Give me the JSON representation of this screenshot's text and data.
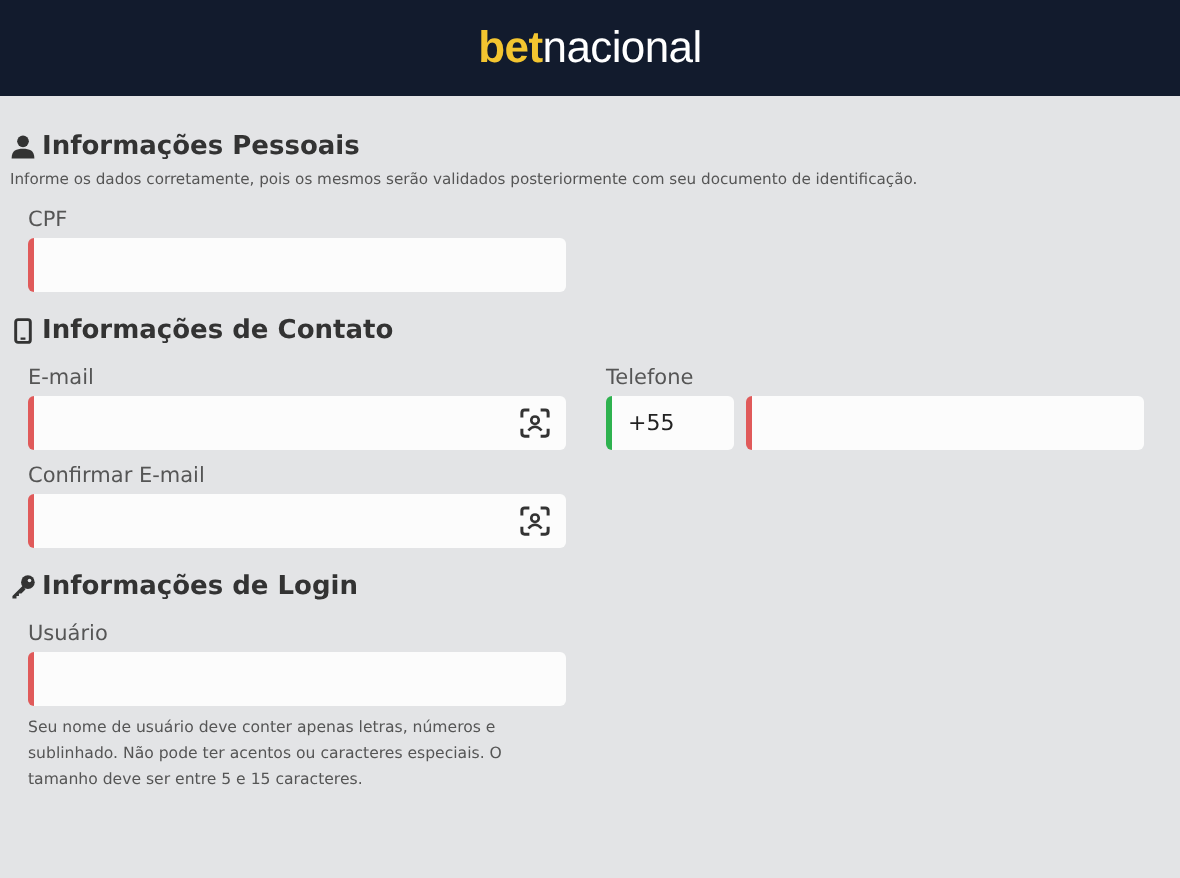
{
  "header": {
    "logo": {
      "accent": "bet",
      "rest": "nacional"
    }
  },
  "sections": [
    {
      "title": "Informações Pessoais",
      "kind": "personal",
      "description": "Informe os dados corretamente, pois os mesmos serão validados posteriormente com seu documento de identificação.",
      "columns": [
        [
          {
            "kind": "text",
            "label": "CPF",
            "valid": false
          }
        ]
      ]
    },
    {
      "title": "Informações de Contato",
      "kind": "contact",
      "columns": [
        [
          {
            "kind": "email",
            "label": "E-mail",
            "valid": false
          },
          {
            "kind": "email",
            "label": "Confirmar E-mail",
            "valid": false
          }
        ],
        [
          {
            "kind": "phone",
            "label": "Telefone",
            "prefix": {
              "value": "+55",
              "valid": true
            },
            "number": {
              "valid": false
            }
          }
        ]
      ]
    },
    {
      "title": "Informações de Login",
      "kind": "login",
      "columns": [
        [
          {
            "kind": "text",
            "label": "Usuário",
            "valid": false,
            "hint": "Seu nome de usuário deve conter apenas letras, números e sublinhado. Não pode ter acentos ou caracteres especiais. O tamanho deve ser entre 5 e 15 caracteres."
          }
        ]
      ]
    }
  ]
}
